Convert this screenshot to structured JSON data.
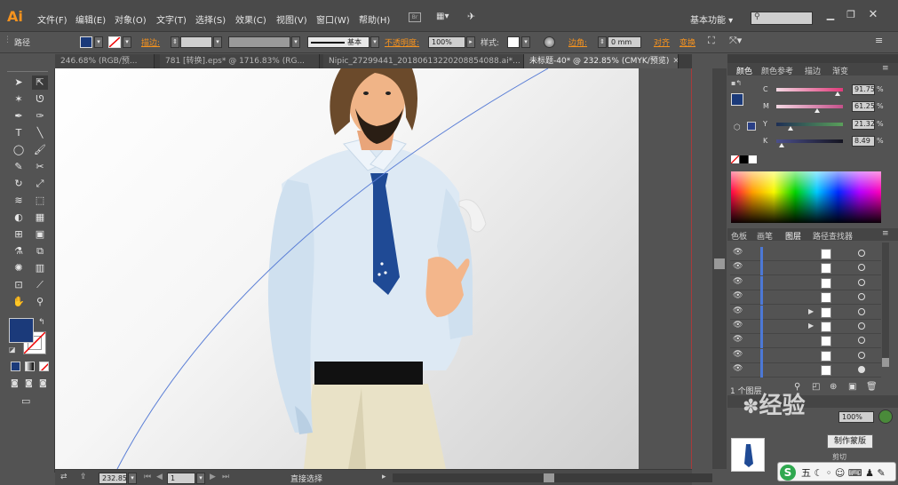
{
  "app": {
    "logo": "Ai",
    "workspace": "基本功能",
    "search_placeholder": ""
  },
  "menu": [
    "文件(F)",
    "编辑(E)",
    "对象(O)",
    "文字(T)",
    "选择(S)",
    "效果(C)",
    "视图(V)",
    "窗口(W)",
    "帮助(H)"
  ],
  "control": {
    "object_type": "路径",
    "stroke_label": "描边:",
    "stroke_style": "基本",
    "opacity_label": "不透明度:",
    "opacity_value": "100%",
    "style_label": "样式:",
    "corner_label": "边角:",
    "corner_value": "0 mm",
    "align_label": "对齐",
    "transform_label": "变换"
  },
  "tabs": [
    {
      "label": "246.68% (RGB/预..."
    },
    {
      "label": "781 [转换].eps* @ 1716.83% (RG..."
    },
    {
      "label": "Nipic_27299441_20180613220208854088.ai*..."
    },
    {
      "label": "未标题-40* @ 232.85% (CMYK/预览)"
    }
  ],
  "color_panel": {
    "tabs": [
      "颜色",
      "颜色参考",
      "描边",
      "渐变"
    ],
    "fill_color": "#1b3a7a",
    "channels": [
      {
        "name": "C",
        "value": "91.75",
        "unit": "%",
        "percent": 91.75
      },
      {
        "name": "M",
        "value": "61.25",
        "unit": "%",
        "percent": 61.25
      },
      {
        "name": "Y",
        "value": "21.32",
        "unit": "%",
        "percent": 21.32
      },
      {
        "name": "K",
        "value": "8.49",
        "unit": "%",
        "percent": 8.49
      }
    ]
  },
  "layers_panel": {
    "tabs": [
      "色板",
      "画笔",
      "图层",
      "路径查找器"
    ],
    "layer_count": "1 个图层",
    "rows": 9
  },
  "lower_panel": {
    "opacity_value": "100%",
    "button_label": "制作蒙版",
    "sub_label": "剪切"
  },
  "status": {
    "zoom": "232.85",
    "page": "1",
    "tool_text": "直接选择"
  },
  "watermark": {
    "text": "经验"
  },
  "accent": "#f7931e"
}
